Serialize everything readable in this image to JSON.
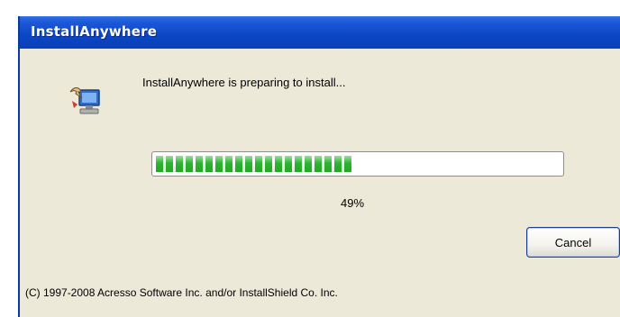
{
  "window": {
    "title": "InstallAnywhere"
  },
  "dialog": {
    "message": "InstallAnywhere is preparing to install...",
    "icon": "installer-computer-icon",
    "progress": {
      "value": 0.49,
      "percent_label": "49%"
    },
    "cancel_label": "Cancel",
    "copyright": "(C) 1997-2008 Acresso Software Inc. and/or InstallShield Co. Inc."
  },
  "colors": {
    "titlebar": "#0a46c4",
    "dialog_bg": "#ece9d8",
    "progress_fill": "#2bb52f"
  }
}
